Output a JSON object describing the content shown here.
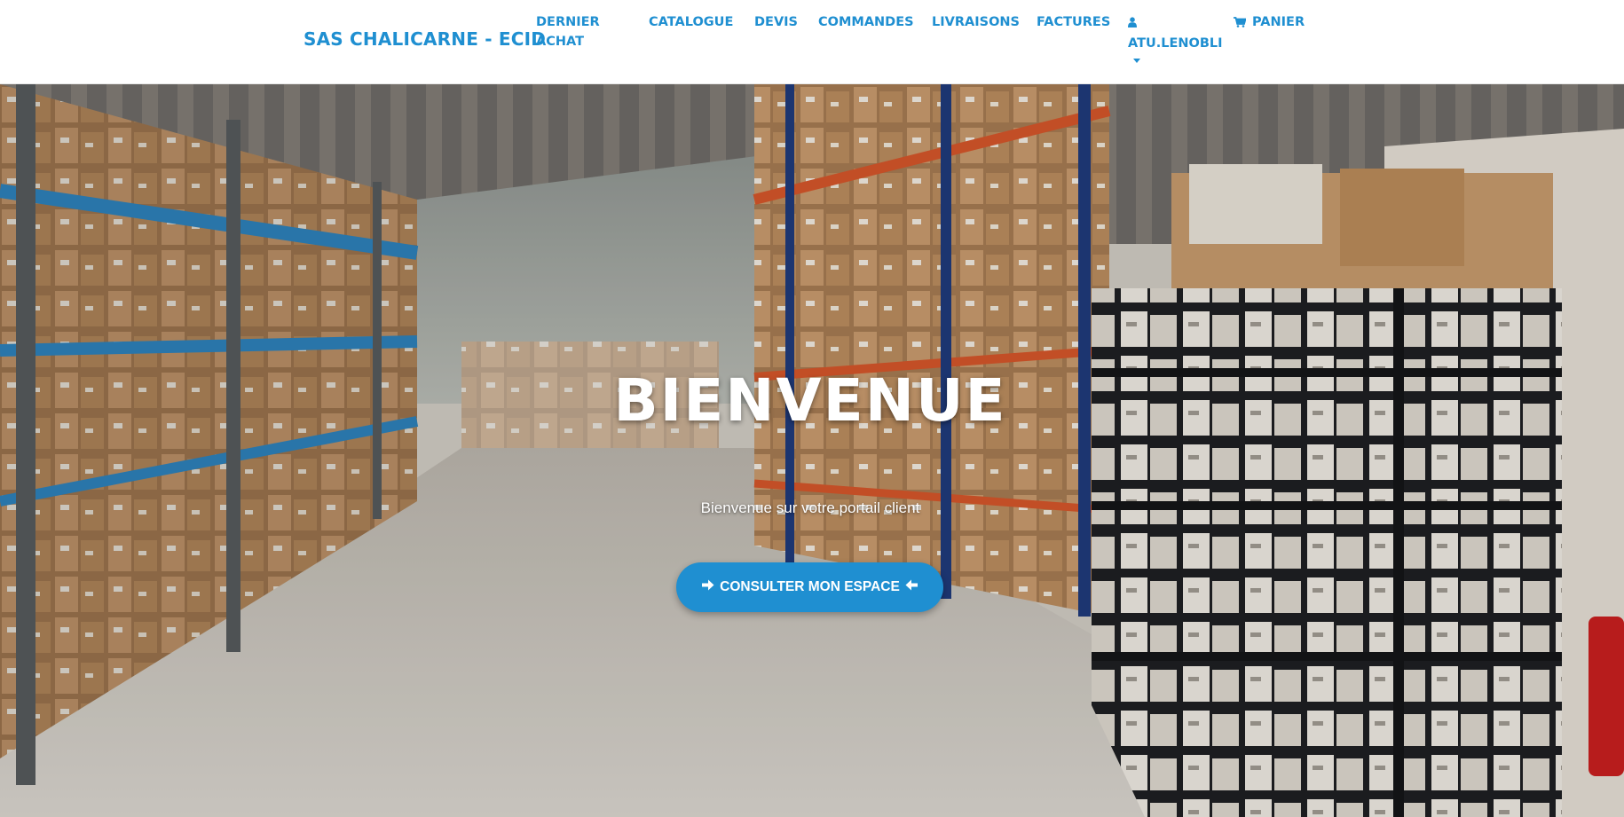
{
  "navbar": {
    "brand": "SAS CHALICARNE - ECID",
    "links": {
      "dernier_achat": "DERNIER ACHAT",
      "catalogue": "CATALOGUE",
      "devis": "DEVIS",
      "commandes": "COMMANDES",
      "livraisons": "LIVRAISONS",
      "factures": "FACTURES",
      "user": "ATU.LENOBLI",
      "panier": "PANIER"
    },
    "icons": {
      "user": "user-icon",
      "cart": "shopping-cart-icon",
      "dropdown": "caret-down-icon"
    }
  },
  "hero": {
    "title": "BIENVENUE",
    "subtitle": "Bienvenue sur votre portail client",
    "cta_label": "CONSULTER MON ESPACE",
    "cta_left_icon": "arrow-right-icon",
    "cta_right_icon": "arrow-left-icon",
    "background": "warehouse-photo"
  },
  "colors": {
    "accent": "#1f8fd1",
    "navbar_bg": "#ffffff",
    "hero_text": "#ffffff"
  }
}
